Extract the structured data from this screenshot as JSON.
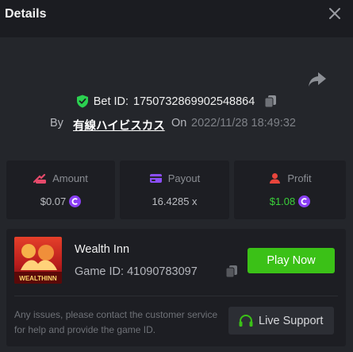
{
  "header": {
    "title": "Details",
    "close_icon": "close-icon"
  },
  "bet": {
    "id_label": "Bet ID:",
    "id_value": "1750732869902548864",
    "by_label": "By",
    "user": "有線ハイビスカス",
    "on_label": "On",
    "datetime": "2022/11/28 18:49:32"
  },
  "stats": [
    {
      "label": "Amount",
      "value": "$0.07",
      "icon": "bet-amount-icon",
      "coin": true
    },
    {
      "label": "Payout",
      "value": "16.4285 x",
      "icon": "payout-card-icon",
      "coin": false
    },
    {
      "label": "Profit",
      "value": "$1.08",
      "icon": "profit-icon",
      "coin": true
    }
  ],
  "game": {
    "name": "Wealth Inn",
    "id_text": "Game ID: 41090783097",
    "thumb_text": "WEALTHINN",
    "play_label": "Play Now",
    "note": "Any issues, please contact the customer service for help and provide the game ID.",
    "support_label": "Live Support"
  },
  "colors": {
    "accent_green": "#3bc117",
    "profit_green": "#3ad03a",
    "coin_purple": "#8a3ff5",
    "shield_green": "#2bd150",
    "amount_pink": "#e64a6b",
    "payout_purple": "#8b4ef6",
    "profit_red": "#e8453c"
  }
}
